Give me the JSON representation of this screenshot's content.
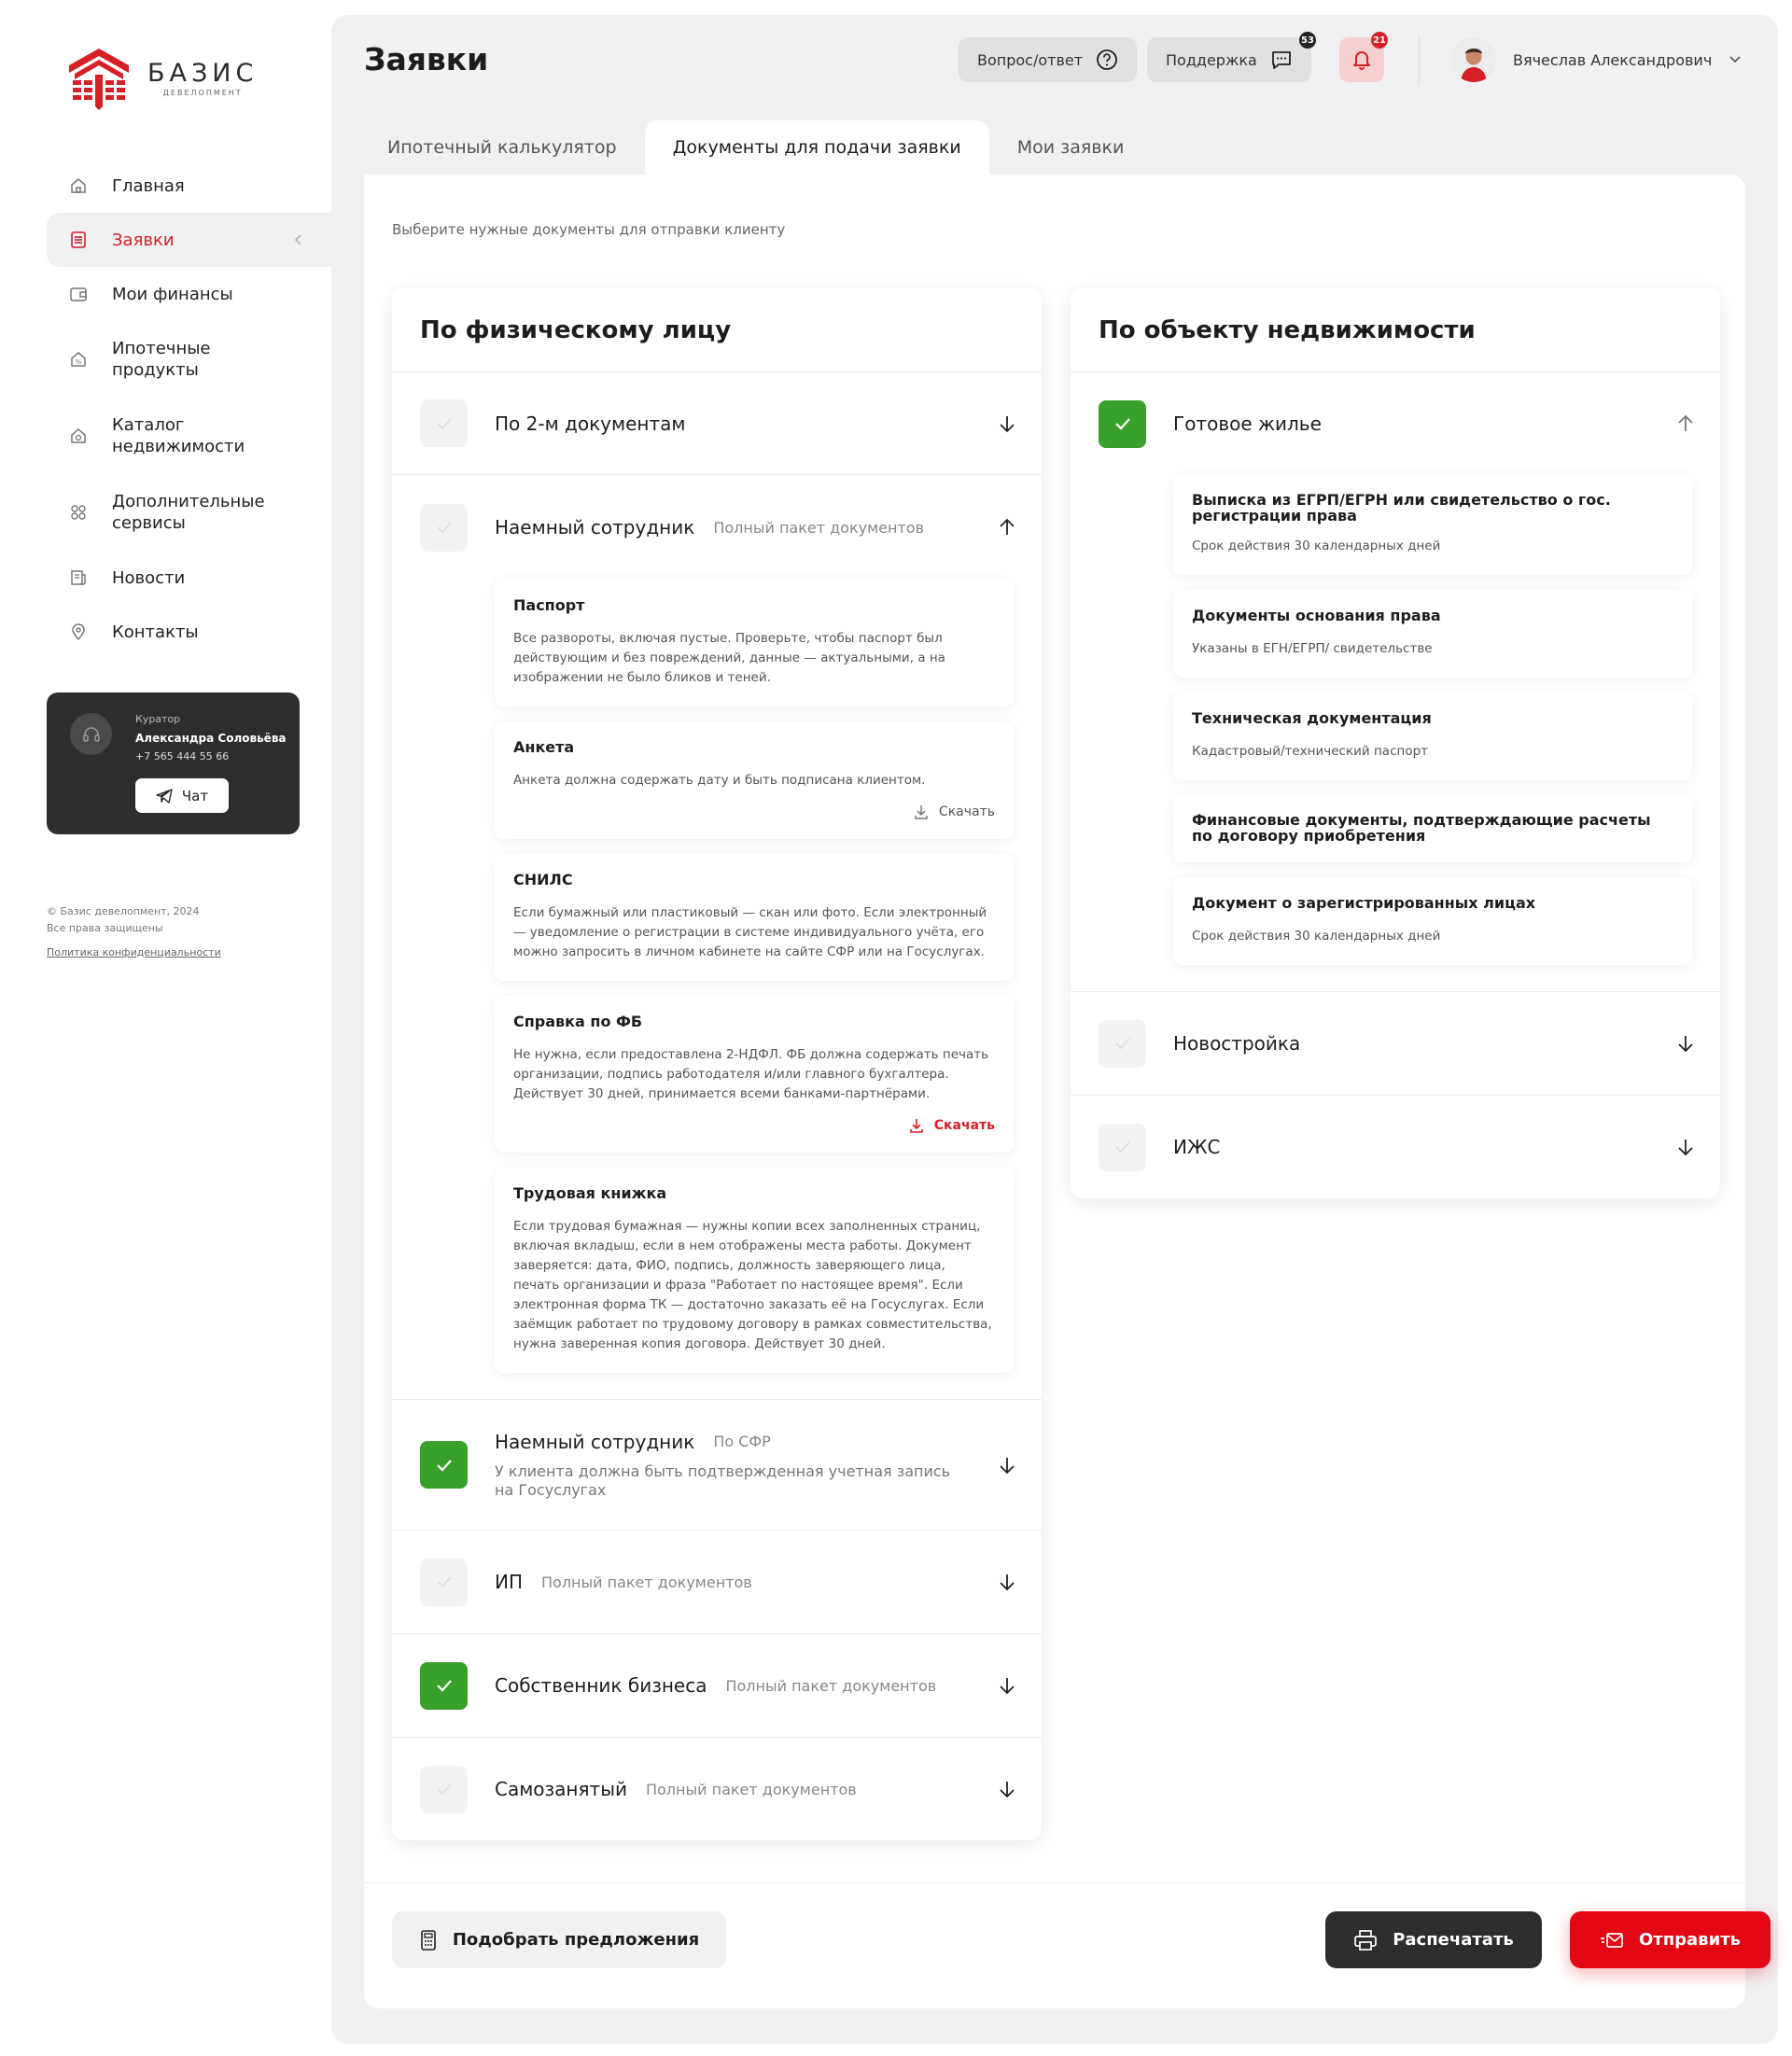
{
  "brand": {
    "name": "БАЗИС",
    "sub": "ДЕВЕЛОПМЕНТ",
    "color": "#d71f26"
  },
  "sidebar": {
    "items": [
      {
        "label": "Главная",
        "icon": "home-icon"
      },
      {
        "label": "Заявки",
        "icon": "document-list-icon"
      },
      {
        "label": "Мои финансы",
        "icon": "wallet-icon"
      },
      {
        "label": "Ипотечные продукты",
        "icon": "house-percent-icon"
      },
      {
        "label": "Каталог недвижимости",
        "icon": "house-search-icon"
      },
      {
        "label": "Дополнительные сервисы",
        "icon": "grid-services-icon"
      },
      {
        "label": "Новости",
        "icon": "newspaper-icon"
      },
      {
        "label": "Контакты",
        "icon": "location-pin-icon"
      }
    ]
  },
  "curator": {
    "role": "Куратор",
    "name": "Александра Соловьёва",
    "phone": "+7 565 444 55 66",
    "chat": "Чат"
  },
  "footer_info": {
    "copyright": "© Базис девелопмент, 2024",
    "rights": "Все права защищены",
    "policy": "Политика конфиденциальности"
  },
  "header": {
    "title": "Заявки",
    "faq": "Вопрос/ответ",
    "support": "Поддержка",
    "support_badge": "53",
    "notif_badge": "21",
    "user": "Вячеслав Александрович"
  },
  "tabs": [
    "Ипотечный калькулятор",
    "Документы для подачи заявки",
    "Мои заявки"
  ],
  "hint": "Выберите нужные документы для отправки клиенту",
  "left": {
    "title": "По физическому лицу",
    "r1": {
      "title": "По 2-м документам"
    },
    "r2": {
      "title": "Наемный сотрудник",
      "sub": "Полный пакет документов",
      "docs": [
        {
          "title": "Паспорт",
          "desc": "Все развороты, включая пустые. Проверьте, чтобы паспорт был действующим и без повреждений, данные — актуальными, а на изображении не было бликов и теней."
        },
        {
          "title": "Анкета",
          "desc": "Анкета должна содержать дату и быть подписана клиентом.",
          "download": "Скачать"
        },
        {
          "title": "СНИЛС",
          "desc": "Если бумажный или пластиковый — скан или фото. Если электронный — уведомление о регистрации в системе индивидуального учёта, его можно запросить в личном кабинете на сайте СФР или на Госуслугах."
        },
        {
          "title": "Справка по ФБ",
          "desc": "Не нужна, если предоставлена 2-НДФЛ. ФБ должна содержать печать организации, подпись работодателя и/или главного бухгалтера. Действует 30 дней, принимается всеми банками-партнёрами.",
          "download": "Скачать"
        },
        {
          "title": "Трудовая книжка",
          "desc": "Если трудовая бумажная — нужны копии всех заполненных страниц, включая вкладыш, если в нем отображены места работы.   Документ заверяется: дата, ФИО, подпись, должность заверяющего лица, печать организации и фраза \"Работает по настоящее время\". Если электронная форма ТК — достаточно заказать её на Госуслугах. Если заёмщик работает по трудовому договору в рамках совместительства, нужна заверенная копия договора. Действует 30 дней."
        }
      ]
    },
    "r3": {
      "title": "Наемный сотрудник",
      "sub": "По СФР",
      "desc": "У клиента должна быть подтвержденная учетная запись на Госуслугах"
    },
    "r4": {
      "title": "ИП",
      "sub": "Полный пакет документов"
    },
    "r5": {
      "title": "Собственник бизнеса",
      "sub": "Полный пакет документов"
    },
    "r6": {
      "title": "Самозанятый",
      "sub": "Полный пакет документов"
    }
  },
  "right": {
    "title": "По объекту недвижимости",
    "r1": {
      "title": "Готовое жилье",
      "docs": [
        {
          "title": "Выписка из ЕГРП/ЕГРН или свидетельство о гос. регистрации права",
          "desc": "Срок действия 30 календарных дней"
        },
        {
          "title": "Документы основания права",
          "desc": "Указаны в ЕГН/ЕГРП/ свидетельстве"
        },
        {
          "title": "Техническая документация",
          "desc": "Кадастровый/технический паспорт"
        },
        {
          "title": "Финансовые документы, подтверждающие расчеты по договору приобретения",
          "desc": ""
        },
        {
          "title": "Документ о зарегистрированных лицах",
          "desc": "Срок действия 30 календарных дней"
        }
      ]
    },
    "r2": {
      "title": "Новостройка"
    },
    "r3": {
      "title": "ИЖС"
    }
  },
  "actions": {
    "select": "Подобрать предложения",
    "print": "Распечатать",
    "send": "Отправить"
  },
  "colors": {
    "accent": "#d71f26",
    "check": "#3aa02c",
    "dark": "#2d2d2d"
  }
}
